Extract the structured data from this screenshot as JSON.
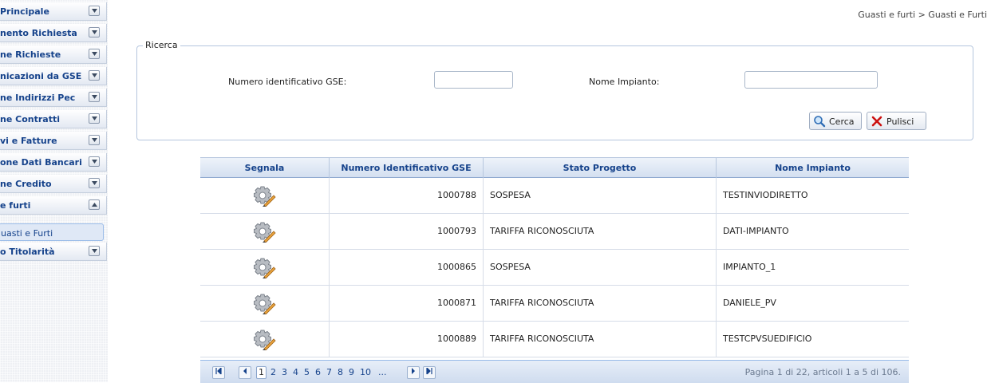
{
  "sidebar": {
    "items": [
      {
        "label": "Principale",
        "expanded": false
      },
      {
        "label": "nento Richiesta",
        "expanded": false
      },
      {
        "label": "ne Richieste",
        "expanded": false
      },
      {
        "label": "nicazioni da GSE",
        "expanded": false
      },
      {
        "label": "ne Indirizzi Pec",
        "expanded": false
      },
      {
        "label": "ne Contratti",
        "expanded": false
      },
      {
        "label": "vi e Fatture",
        "expanded": false
      },
      {
        "label": "one Dati Bancari",
        "expanded": false
      },
      {
        "label": "ne Credito",
        "expanded": false
      },
      {
        "label": "e furti",
        "expanded": true
      },
      {
        "label": "o Titolarità",
        "expanded": false
      }
    ],
    "sub_item": "uasti e Furti"
  },
  "breadcrumb": "Guasti e furti > Guasti e Furti",
  "search": {
    "legend": "Ricerca",
    "field1_label": "Numero identificativo GSE:",
    "field1_value": "",
    "field2_label": "Nome Impianto:",
    "field2_value": "",
    "search_button": "Cerca",
    "clear_button": "Pulisci"
  },
  "grid": {
    "columns": [
      "Segnala",
      "Numero Identificativo GSE",
      "Stato Progetto",
      "Nome Impianto"
    ],
    "rows": [
      {
        "number": "1000788",
        "status": "SOSPESA",
        "name": "TESTINVIODIRETTO"
      },
      {
        "number": "1000793",
        "status": "TARIFFA RICONOSCIUTA",
        "name": "DATI-IMPIANTO"
      },
      {
        "number": "1000865",
        "status": "SOSPESA",
        "name": "IMPIANTO_1"
      },
      {
        "number": "1000871",
        "status": "TARIFFA RICONOSCIUTA",
        "name": "DANIELE_PV"
      },
      {
        "number": "1000889",
        "status": "TARIFFA RICONOSCIUTA",
        "name": "TESTCPVSUEDIFICIO"
      }
    ]
  },
  "pager": {
    "pages": [
      "1",
      "2",
      "3",
      "4",
      "5",
      "6",
      "7",
      "8",
      "9",
      "10",
      "..."
    ],
    "current_page": "1",
    "info": "Pagina 1 di 22, articoli 1 a 5 di 106."
  },
  "icons": {
    "row_action": "gear-wrench-icon",
    "search": "magnifier-icon",
    "clear": "red-x-icon"
  },
  "colors": {
    "header_text": "#15428b",
    "border_blue": "#99bbe8",
    "clear_icon": "#cc1111"
  }
}
